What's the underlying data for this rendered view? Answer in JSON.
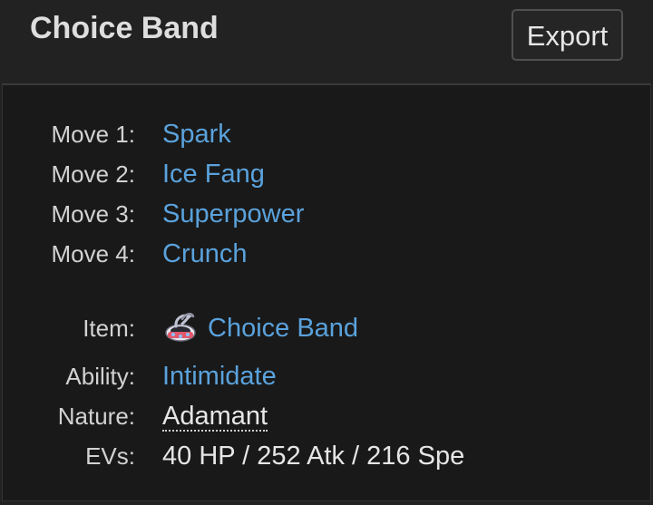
{
  "header": {
    "title": "Choice Band",
    "export_label": "Export"
  },
  "details": {
    "moves": [
      {
        "label": "Move 1:",
        "value": "Spark"
      },
      {
        "label": "Move 2:",
        "value": "Ice Fang"
      },
      {
        "label": "Move 3:",
        "value": "Superpower"
      },
      {
        "label": "Move 4:",
        "value": "Crunch"
      }
    ],
    "item": {
      "label": "Item:",
      "value": "Choice Band",
      "icon": "choice-band-icon"
    },
    "ability": {
      "label": "Ability:",
      "value": "Intimidate"
    },
    "nature": {
      "label": "Nature:",
      "value": "Adamant"
    },
    "evs": {
      "label": "EVs:",
      "value": "40 HP / 252 Atk / 216 Spe"
    }
  },
  "colors": {
    "link": "#5aa2dc",
    "background": "#191919",
    "header_background": "#222222",
    "label_text": "#d2d2d2"
  }
}
